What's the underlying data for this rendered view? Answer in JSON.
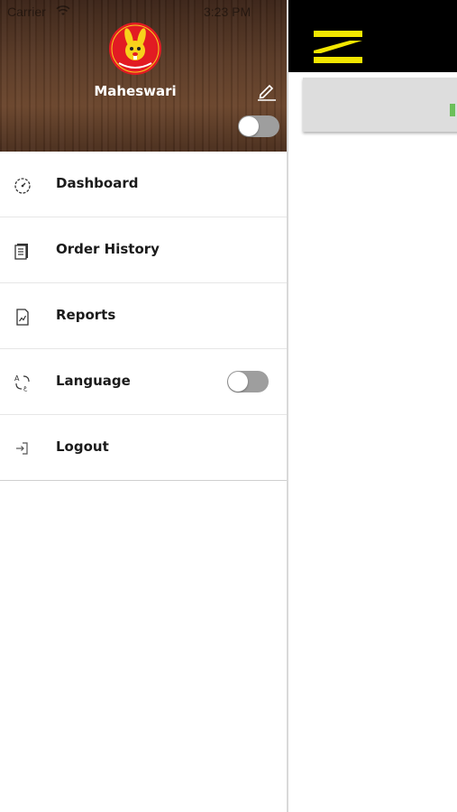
{
  "status_bar": {
    "carrier": "Carrier",
    "time": "3:23 PM"
  },
  "header": {
    "logo_icon": "hungry-bunny-logo",
    "user_name": "Maheswari",
    "edit_icon": "pencil-icon",
    "toggle_on": false
  },
  "menu": {
    "items": [
      {
        "label": "Dashboard",
        "icon": "speedometer-icon"
      },
      {
        "label": "Order History",
        "icon": "document-list-icon"
      },
      {
        "label": "Reports",
        "icon": "report-chart-icon"
      },
      {
        "label": "Language",
        "icon": "translate-icon",
        "toggle_on": false
      },
      {
        "label": "Logout",
        "icon": "logout-icon"
      }
    ]
  },
  "main": {
    "menu_icon": "hamburger-menu-icon",
    "accent_color": "#f2e600",
    "topbar_color": "#000000"
  }
}
